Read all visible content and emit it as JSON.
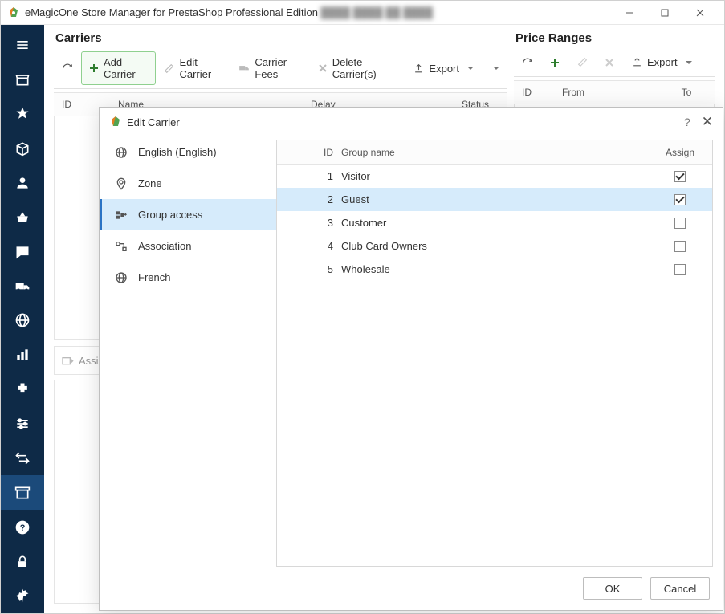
{
  "window": {
    "title_main": "eMagicOne Store Manager for PrestaShop Professional Edition",
    "title_blur": "████ ████ ██ ████"
  },
  "left_panel": {
    "title": "Carriers",
    "toolbar": {
      "add": "Add Carrier",
      "edit": "Edit Carrier",
      "fees": "Carrier Fees",
      "del": "Delete Carrier(s)",
      "export": "Export"
    },
    "cols": {
      "id": "ID",
      "name": "Name",
      "delay": "Delay",
      "status": "Status"
    },
    "assign_btn": "Assign"
  },
  "right_panel": {
    "title": "Price Ranges",
    "toolbar": {
      "export": "Export"
    },
    "cols": {
      "id": "ID",
      "from": "From",
      "to": "To"
    }
  },
  "dialog": {
    "title": "Edit Carrier",
    "nav": {
      "lang": "English (English)",
      "zone": "Zone",
      "group": "Group access",
      "assoc": "Association",
      "french": "French"
    },
    "group_cols": {
      "id": "ID",
      "name": "Group name",
      "assign": "Assign"
    },
    "groups": [
      {
        "id": "1",
        "name": "Visitor",
        "assigned": true,
        "selected": false
      },
      {
        "id": "2",
        "name": "Guest",
        "assigned": true,
        "selected": true
      },
      {
        "id": "3",
        "name": "Customer",
        "assigned": false,
        "selected": false
      },
      {
        "id": "4",
        "name": "Club Card Owners",
        "assigned": false,
        "selected": false
      },
      {
        "id": "5",
        "name": "Wholesale",
        "assigned": false,
        "selected": false
      }
    ],
    "buttons": {
      "ok": "OK",
      "cancel": "Cancel"
    }
  }
}
